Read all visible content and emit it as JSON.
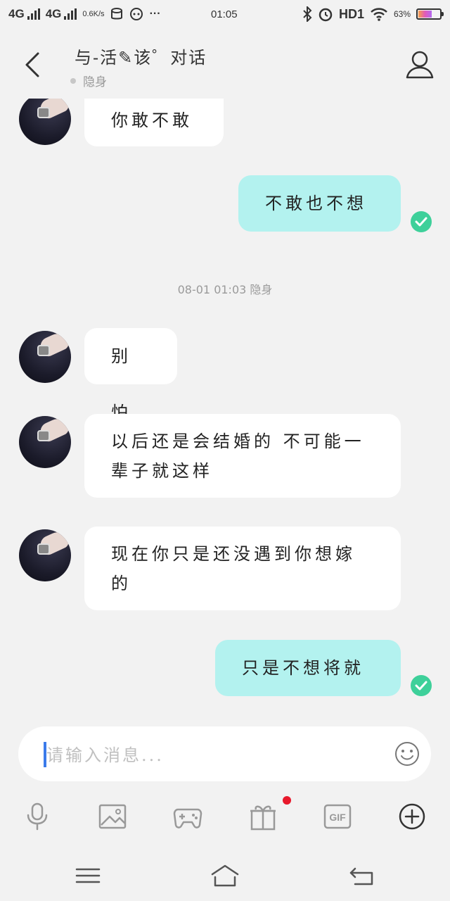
{
  "status_bar": {
    "signal1": "4G",
    "signal2": "4G",
    "net_speed": "0.6K/s",
    "time": "01:05",
    "hd": "HD1",
    "battery_percent": "63%",
    "battery_level": 0.63,
    "icons": [
      "data-saver-icon",
      "chat-bubble-icon",
      "more-dots-icon",
      "bluetooth-icon",
      "alarm-icon",
      "wifi-icon",
      "battery-icon"
    ]
  },
  "header": {
    "title": "与-活✎该゜对话",
    "presence": "隐身"
  },
  "messages": [
    {
      "side": "in",
      "text": "你敢不敢"
    },
    {
      "side": "out",
      "text": "不敢也不想",
      "status": "delivered"
    },
    {
      "type": "timestamp",
      "text": "08-01 01:03 隐身"
    },
    {
      "side": "in",
      "text": "别怕"
    },
    {
      "side": "in",
      "text": "以后还是会结婚的 不可能一辈子就这样"
    },
    {
      "side": "out_placeholder"
    },
    {
      "side": "in",
      "text": "现在你只是还没遇到你想嫁的"
    },
    {
      "side": "out",
      "text": "只是不想将就",
      "status": "delivered"
    }
  ],
  "input": {
    "placeholder": "请输入消息..."
  },
  "toolbar": {
    "items": [
      "microphone-icon",
      "image-icon",
      "gamepad-icon",
      "gift-icon",
      "gif-icon",
      "add-circle-icon"
    ],
    "gif_label": "GIF",
    "gift_has_badge": true
  },
  "colors": {
    "background": "#f2f2f2",
    "incoming_bubble": "#ffffff",
    "outgoing_bubble": "#b3f2ef",
    "check": "#3ed09a",
    "badge": "#e8192c",
    "cursor": "#3b7bea"
  }
}
